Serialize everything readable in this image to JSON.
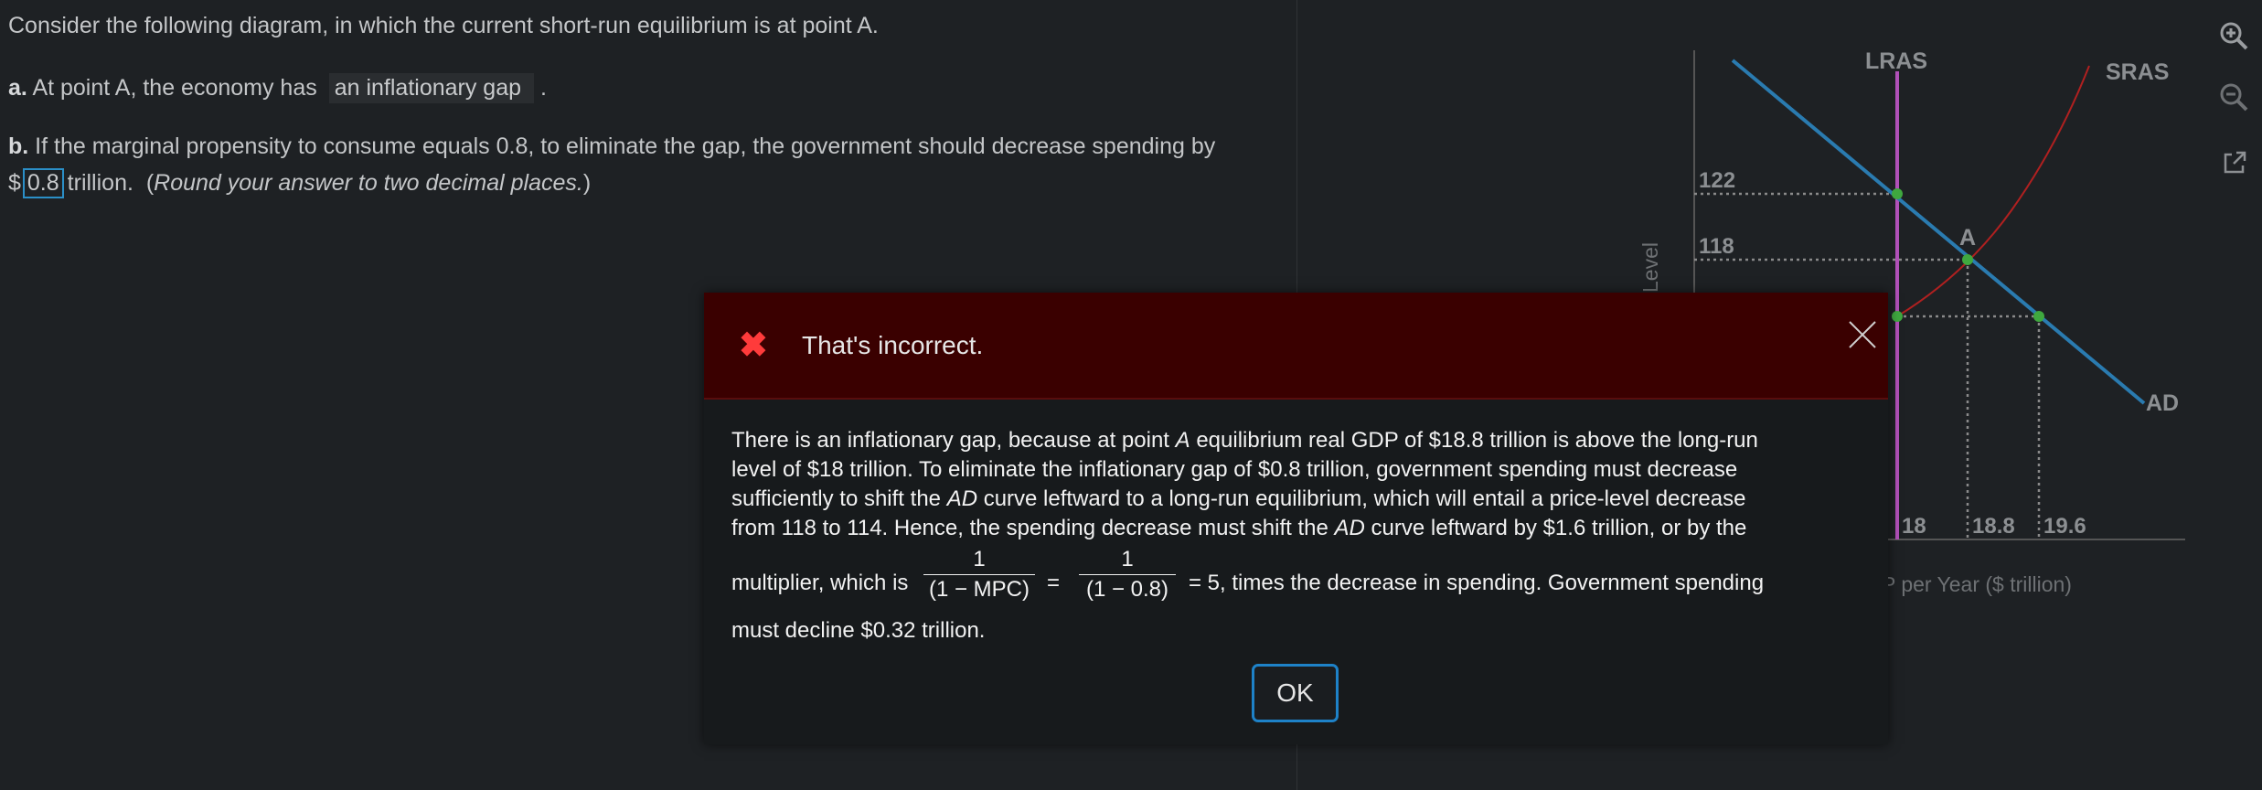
{
  "question": {
    "intro": "Consider the following diagram, in which the current short-run equilibrium is at point A.",
    "part_a": {
      "label": "a.",
      "prefix": "At point A, the economy has",
      "answer": "an inflationary gap",
      "suffix": "."
    },
    "part_b": {
      "label": "b.",
      "line1": "If the marginal propensity to consume equals 0.8, to eliminate the gap, the government should decrease spending by",
      "currency": "$",
      "answer": "0.8",
      "unit": "trillion.",
      "hint_open": "(",
      "hint": "Round your answer to two decimal places.",
      "hint_close": ")"
    }
  },
  "graph": {
    "lras_label": "LRAS",
    "sras_label": "SRAS",
    "ad_label": "AD",
    "point_a_label": "A",
    "y_ticks": [
      "122",
      "118"
    ],
    "x_ticks": [
      "18",
      "18.8",
      "19.6"
    ],
    "y_axis_label_partial": "Level",
    "x_axis_label_partial": "P per Year ($ trillion)",
    "colors": {
      "lras": "#b050b8",
      "sras": "#b02020",
      "ad": "#2a7bb0",
      "points": "#3fa83f"
    }
  },
  "tools": {
    "zoom_in": "zoom-in-icon",
    "zoom_out": "zoom-out-icon",
    "popout": "external-link-icon"
  },
  "feedback": {
    "title": "That's incorrect.",
    "line1_a": "There is an inflationary gap, because at point ",
    "line1_i": "A",
    "line1_b": " equilibrium real GDP of $18.8 trillion is above the long-run",
    "line2": "level of $18 trillion. To eliminate the inflationary gap of $0.8 trillion, government spending must decrease",
    "line3_a": "sufficiently to shift the ",
    "line3_i": "AD",
    "line3_b": " curve leftward to a long-run equilibrium, which will entail a price-level decrease",
    "line4_a": "from 118 to 114. Hence, the spending decrease must shift the ",
    "line4_i": "AD",
    "line4_b": " curve leftward by $1.6 trillion, or by the",
    "line5_a": "multiplier, which is",
    "frac1_num": "1",
    "frac1_den": "(1 − MPC)",
    "eq1": "=",
    "frac2_num": "1",
    "frac2_den": "(1 − 0.8)",
    "line5_b": "=  5, times the decrease in spending. Government spending",
    "line6": "must decline $0.32 trillion.",
    "ok_label": "OK"
  }
}
